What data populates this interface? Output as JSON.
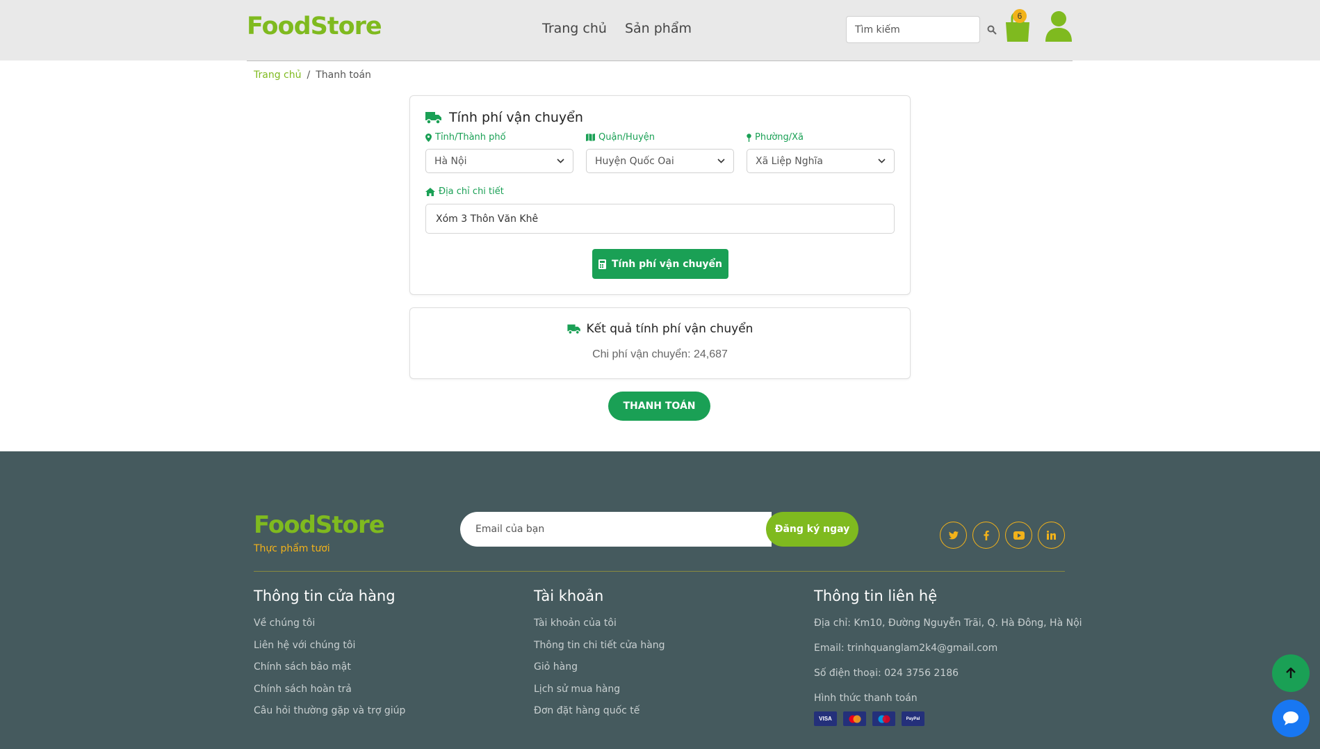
{
  "brand": {
    "name": "FoodStore",
    "accent": "#7fba1f",
    "green": "#1aa055",
    "yellow": "#f2b21a"
  },
  "header": {
    "nav": [
      "Trang chủ",
      "Sản phẩm"
    ],
    "search_placeholder": "Tìm kiếm",
    "cart_count": "6",
    "icons": {
      "search": "search-icon",
      "cart": "shopping-bag-icon",
      "user": "user-icon"
    }
  },
  "breadcrumb": {
    "home": "Trang chủ",
    "separator": "/",
    "current": "Thanh toán"
  },
  "shipping": {
    "title": "Tính phí vận chuyển",
    "province_label": "Tỉnh/Thành phố",
    "province_value": "Hà Nội",
    "district_label": "Quận/Huyện",
    "district_value": "Huyện Quốc Oai",
    "ward_label": "Phường/Xã",
    "ward_value": "Xã Liệp Nghĩa",
    "address_label": "Địa chỉ chi tiết",
    "address_value": "Xóm 3 Thôn Văn Khê",
    "calc_button": "Tính phí vận chuyển"
  },
  "result": {
    "title": "Kết quả tính phí vận chuyển",
    "value": "Chi phí vận chuyển: 24,687"
  },
  "checkout_button": "THANH TOÁN",
  "footer": {
    "logo": "FoodStore",
    "tagline": "Thực phẩm tươi",
    "newsletter_placeholder": "Email của bạn",
    "newsletter_button": "Đăng ký ngay",
    "social": [
      "twitter-icon",
      "facebook-icon",
      "youtube-icon",
      "linkedin-icon"
    ],
    "col1": {
      "title": "Thông tin cửa hàng",
      "links": [
        "Về chúng tôi",
        "Liên hệ với chúng tôi",
        "Chính sách bảo mật",
        "Chính sách hoàn trả",
        "Câu hỏi thường gặp và trợ giúp"
      ]
    },
    "col2": {
      "title": "Tài khoản",
      "links": [
        "Tài khoản của tôi",
        "Thông tin chi tiết cửa hàng",
        "Giỏ hàng",
        "Lịch sử mua hàng",
        "Đơn đặt hàng quốc tế"
      ]
    },
    "col3": {
      "title": "Thông tin liên hệ",
      "address": "Địa chỉ: Km10, Đường Nguyễn Trãi, Q. Hà Đông, Hà Nội",
      "email": "Email: trinhquanglam2k4@gmail.com",
      "phone": "Số điện thoại: 024 3756 2186",
      "payment_title": "Hình thức thanh toán",
      "payment_methods": [
        "VISA",
        "MasterCard",
        "Maestro",
        "PayPal"
      ]
    }
  }
}
